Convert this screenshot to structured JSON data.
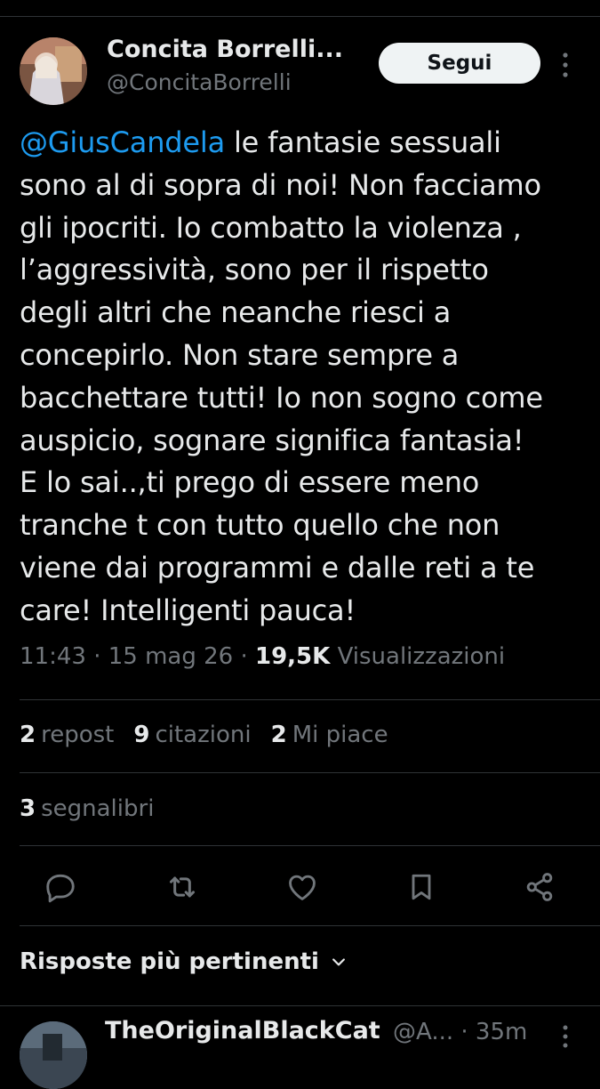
{
  "tweet": {
    "author_name": "Concita Borrelli...",
    "author_handle": "@ConcitaBorrelli",
    "follow_label": "Segui",
    "mention": "@GiusCandela",
    "text": " le fantasie sessuali\nsono al di sopra di noi! Non facciamo\ngli ipocriti. Io combatto la violenza ,\nl’aggressività, sono per il rispetto\ndegli altri che neanche riesci a\nconcepirlo. Non stare sempre a\nbacchettare tutti! Io non sogno come\nauspicio, sognare significa fantasia!\nE lo sai..,ti prego di essere meno\ntranche t con tutto quello che non\nviene dai programmi e dalle reti a te\ncare! Intelligenti pauca!",
    "time": "11:43",
    "date": "15 mag 26",
    "views_count": "19,5K",
    "views_label": "Visualizzazioni",
    "separator": " · "
  },
  "stats": {
    "reposts_count": "2",
    "reposts_label": "repost",
    "quotes_count": "9",
    "quotes_label": "citazioni",
    "likes_count": "2",
    "likes_label": "Mi piace",
    "bookmarks_count": "3",
    "bookmarks_label": "segnalibri"
  },
  "actions": {
    "icons": [
      "reply-icon",
      "repost-icon",
      "like-icon",
      "bookmark-icon",
      "share-icon"
    ]
  },
  "replies": {
    "sort_label": "Risposte più pertinenti",
    "first_reply": {
      "name": "TheOriginalBlackCat",
      "handle_time": "@A... · 35m"
    }
  },
  "colors": {
    "background": "#000000",
    "text": "#e7e9ea",
    "muted": "#71767b",
    "accent": "#1d9bf0",
    "divider": "#2f3336"
  }
}
